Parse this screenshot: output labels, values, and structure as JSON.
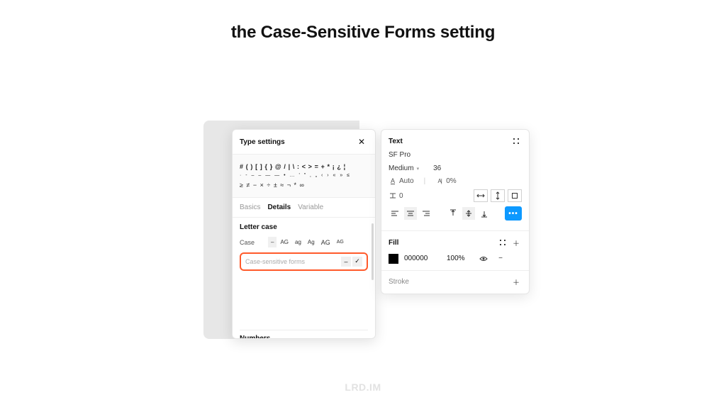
{
  "title": "the Case-Sensitive Forms setting",
  "watermark": "LRD.IM",
  "type_settings": {
    "panel_title": "Type settings",
    "preview": {
      "line1": "# ( ) [ ] { } @ / | \\ : < > = + * ¡ ¿ ¦",
      "line2": "· ‐ ‒ – — ― • … ' \" ‚ „ ‹ › « » ≤",
      "line3": "≥ ≠ − × ÷ ± ≈ ¬ * ∞"
    },
    "tabs": {
      "basics": "Basics",
      "details": "Details",
      "variable": "Variable",
      "active": "Details"
    },
    "letter_case": {
      "section": "Letter case",
      "case_label": "Case",
      "options": {
        "none": "–",
        "upper": "AG",
        "lower": "ag",
        "title": "Ag",
        "smallcaps": "AG",
        "allsmall": "AG"
      },
      "csf_label": "Case-sensitive forms",
      "csf_dash": "–",
      "csf_check": "✓"
    },
    "next_section": "Numbers"
  },
  "text_panel": {
    "header": "Text",
    "font": "SF Pro",
    "weight": "Medium",
    "size": "36",
    "line_height": "Auto",
    "letter_spacing": "0%",
    "paragraph_spacing": "0",
    "fill": {
      "header": "Fill",
      "hex": "000000",
      "opacity": "100%"
    },
    "stroke": {
      "header": "Stroke"
    },
    "more": "•••"
  }
}
